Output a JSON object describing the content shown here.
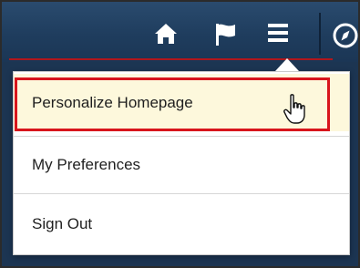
{
  "header": {
    "icons": {
      "home": "home-icon",
      "flag": "flag-icon",
      "menu": "hamburger-menu-icon",
      "navigator": "compass-icon"
    }
  },
  "dropdown": {
    "items": [
      {
        "label": "Personalize Homepage",
        "state": "hovered"
      },
      {
        "label": "My Preferences"
      },
      {
        "label": "Sign Out"
      }
    ]
  },
  "colors": {
    "header": "#1f3d5e",
    "highlight_border": "#d8151c",
    "hover_bg": "#fdf8dc"
  }
}
